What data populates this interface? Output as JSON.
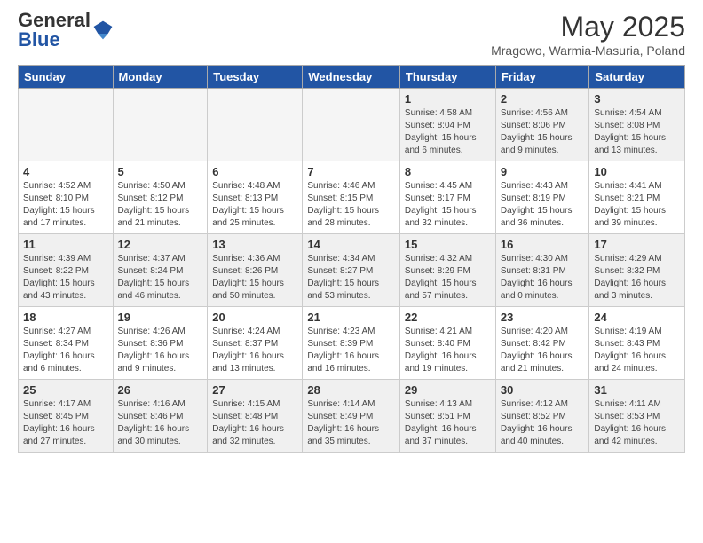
{
  "header": {
    "logo_general": "General",
    "logo_blue": "Blue",
    "month_title": "May 2025",
    "location": "Mragowo, Warmia-Masuria, Poland"
  },
  "days_of_week": [
    "Sunday",
    "Monday",
    "Tuesday",
    "Wednesday",
    "Thursday",
    "Friday",
    "Saturday"
  ],
  "weeks": [
    [
      {
        "day": "",
        "info": "",
        "empty": true
      },
      {
        "day": "",
        "info": "",
        "empty": true
      },
      {
        "day": "",
        "info": "",
        "empty": true
      },
      {
        "day": "",
        "info": "",
        "empty": true
      },
      {
        "day": "1",
        "info": "Sunrise: 4:58 AM\nSunset: 8:04 PM\nDaylight: 15 hours\nand 6 minutes."
      },
      {
        "day": "2",
        "info": "Sunrise: 4:56 AM\nSunset: 8:06 PM\nDaylight: 15 hours\nand 9 minutes."
      },
      {
        "day": "3",
        "info": "Sunrise: 4:54 AM\nSunset: 8:08 PM\nDaylight: 15 hours\nand 13 minutes."
      }
    ],
    [
      {
        "day": "4",
        "info": "Sunrise: 4:52 AM\nSunset: 8:10 PM\nDaylight: 15 hours\nand 17 minutes."
      },
      {
        "day": "5",
        "info": "Sunrise: 4:50 AM\nSunset: 8:12 PM\nDaylight: 15 hours\nand 21 minutes."
      },
      {
        "day": "6",
        "info": "Sunrise: 4:48 AM\nSunset: 8:13 PM\nDaylight: 15 hours\nand 25 minutes."
      },
      {
        "day": "7",
        "info": "Sunrise: 4:46 AM\nSunset: 8:15 PM\nDaylight: 15 hours\nand 28 minutes."
      },
      {
        "day": "8",
        "info": "Sunrise: 4:45 AM\nSunset: 8:17 PM\nDaylight: 15 hours\nand 32 minutes."
      },
      {
        "day": "9",
        "info": "Sunrise: 4:43 AM\nSunset: 8:19 PM\nDaylight: 15 hours\nand 36 minutes."
      },
      {
        "day": "10",
        "info": "Sunrise: 4:41 AM\nSunset: 8:21 PM\nDaylight: 15 hours\nand 39 minutes."
      }
    ],
    [
      {
        "day": "11",
        "info": "Sunrise: 4:39 AM\nSunset: 8:22 PM\nDaylight: 15 hours\nand 43 minutes."
      },
      {
        "day": "12",
        "info": "Sunrise: 4:37 AM\nSunset: 8:24 PM\nDaylight: 15 hours\nand 46 minutes."
      },
      {
        "day": "13",
        "info": "Sunrise: 4:36 AM\nSunset: 8:26 PM\nDaylight: 15 hours\nand 50 minutes."
      },
      {
        "day": "14",
        "info": "Sunrise: 4:34 AM\nSunset: 8:27 PM\nDaylight: 15 hours\nand 53 minutes."
      },
      {
        "day": "15",
        "info": "Sunrise: 4:32 AM\nSunset: 8:29 PM\nDaylight: 15 hours\nand 57 minutes."
      },
      {
        "day": "16",
        "info": "Sunrise: 4:30 AM\nSunset: 8:31 PM\nDaylight: 16 hours\nand 0 minutes."
      },
      {
        "day": "17",
        "info": "Sunrise: 4:29 AM\nSunset: 8:32 PM\nDaylight: 16 hours\nand 3 minutes."
      }
    ],
    [
      {
        "day": "18",
        "info": "Sunrise: 4:27 AM\nSunset: 8:34 PM\nDaylight: 16 hours\nand 6 minutes."
      },
      {
        "day": "19",
        "info": "Sunrise: 4:26 AM\nSunset: 8:36 PM\nDaylight: 16 hours\nand 9 minutes."
      },
      {
        "day": "20",
        "info": "Sunrise: 4:24 AM\nSunset: 8:37 PM\nDaylight: 16 hours\nand 13 minutes."
      },
      {
        "day": "21",
        "info": "Sunrise: 4:23 AM\nSunset: 8:39 PM\nDaylight: 16 hours\nand 16 minutes."
      },
      {
        "day": "22",
        "info": "Sunrise: 4:21 AM\nSunset: 8:40 PM\nDaylight: 16 hours\nand 19 minutes."
      },
      {
        "day": "23",
        "info": "Sunrise: 4:20 AM\nSunset: 8:42 PM\nDaylight: 16 hours\nand 21 minutes."
      },
      {
        "day": "24",
        "info": "Sunrise: 4:19 AM\nSunset: 8:43 PM\nDaylight: 16 hours\nand 24 minutes."
      }
    ],
    [
      {
        "day": "25",
        "info": "Sunrise: 4:17 AM\nSunset: 8:45 PM\nDaylight: 16 hours\nand 27 minutes."
      },
      {
        "day": "26",
        "info": "Sunrise: 4:16 AM\nSunset: 8:46 PM\nDaylight: 16 hours\nand 30 minutes."
      },
      {
        "day": "27",
        "info": "Sunrise: 4:15 AM\nSunset: 8:48 PM\nDaylight: 16 hours\nand 32 minutes."
      },
      {
        "day": "28",
        "info": "Sunrise: 4:14 AM\nSunset: 8:49 PM\nDaylight: 16 hours\nand 35 minutes."
      },
      {
        "day": "29",
        "info": "Sunrise: 4:13 AM\nSunset: 8:51 PM\nDaylight: 16 hours\nand 37 minutes."
      },
      {
        "day": "30",
        "info": "Sunrise: 4:12 AM\nSunset: 8:52 PM\nDaylight: 16 hours\nand 40 minutes."
      },
      {
        "day": "31",
        "info": "Sunrise: 4:11 AM\nSunset: 8:53 PM\nDaylight: 16 hours\nand 42 minutes."
      }
    ]
  ]
}
